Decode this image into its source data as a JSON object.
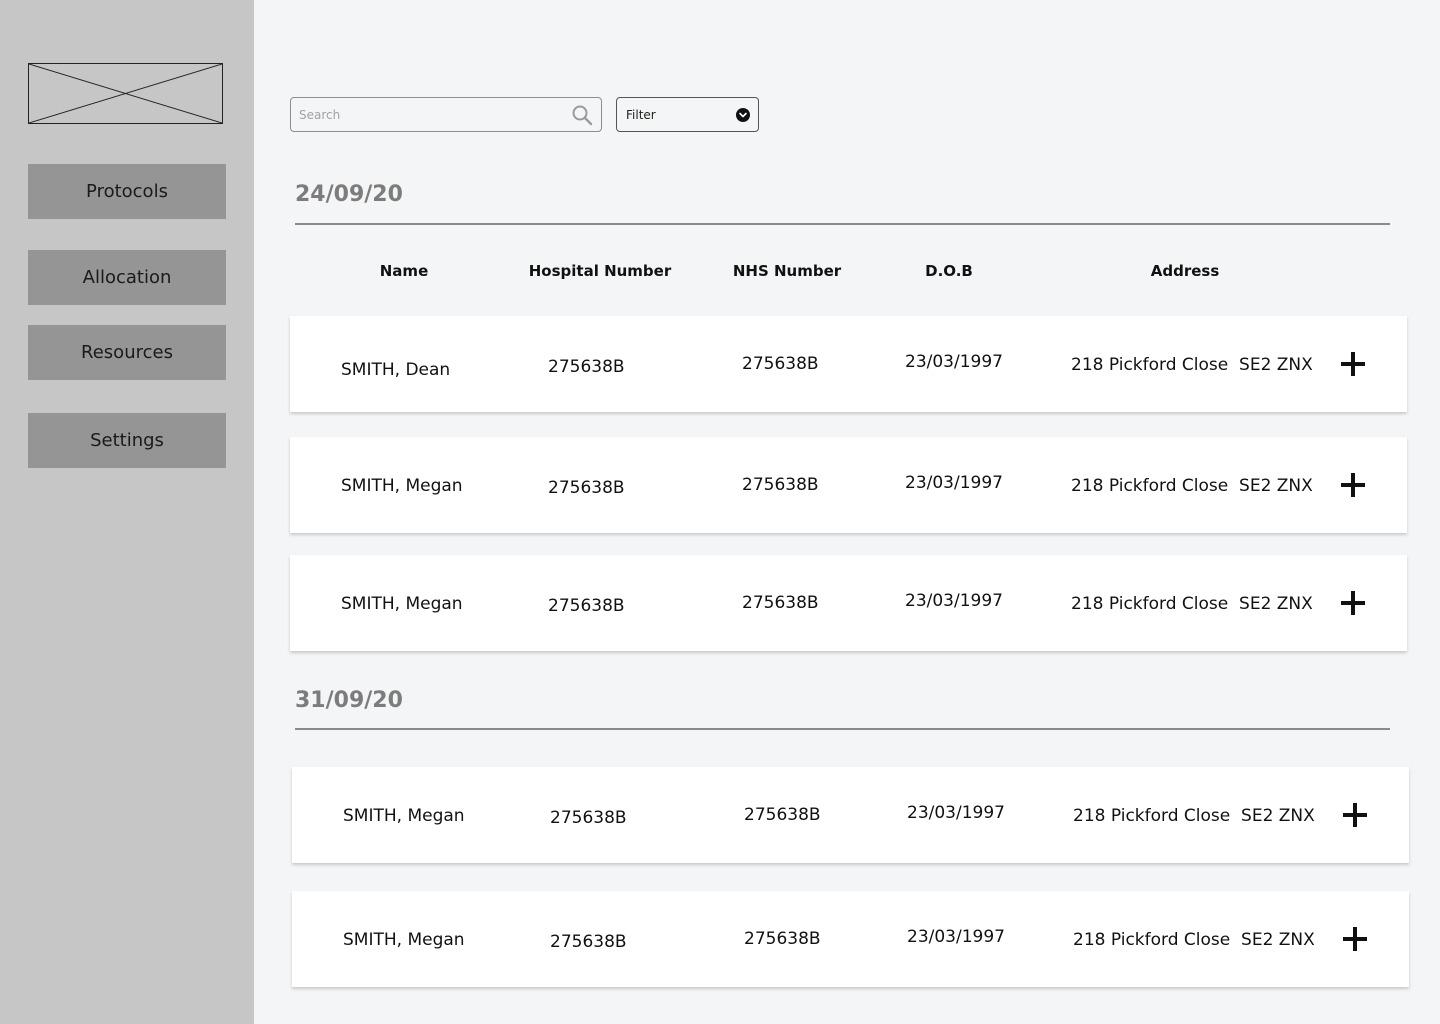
{
  "sidebar": {
    "logo_icon": "image-placeholder-icon",
    "items": [
      {
        "label": "Protocols"
      },
      {
        "label": "Allocation"
      },
      {
        "label": "Resources"
      },
      {
        "label": "Settings"
      }
    ]
  },
  "toolbar": {
    "search_placeholder": "Search",
    "search_icon": "search-icon",
    "filter_label": "Filter",
    "filter_icon": "chevron-down-icon"
  },
  "table": {
    "columns": [
      "Name",
      "Hospital Number",
      "NHS Number",
      "D.O.B",
      "Address"
    ],
    "add_icon": "plus-icon"
  },
  "sections": [
    {
      "date": "24/09/20",
      "rows": [
        {
          "name": "SMITH, Dean",
          "hospital_number": "275638B",
          "nhs_number": "275638B",
          "dob": "23/03/1997",
          "address": "218 Pickford Close  SE2 ZNX"
        },
        {
          "name": "SMITH, Megan",
          "hospital_number": "275638B",
          "nhs_number": "275638B",
          "dob": "23/03/1997",
          "address": "218 Pickford Close  SE2 ZNX"
        },
        {
          "name": "SMITH, Megan",
          "hospital_number": "275638B",
          "nhs_number": "275638B",
          "dob": "23/03/1997",
          "address": "218 Pickford Close  SE2 ZNX"
        }
      ]
    },
    {
      "date": "31/09/20",
      "rows": [
        {
          "name": "SMITH, Megan",
          "hospital_number": "275638B",
          "nhs_number": "275638B",
          "dob": "23/03/1997",
          "address": "218 Pickford Close  SE2 ZNX"
        },
        {
          "name": "SMITH, Megan",
          "hospital_number": "275638B",
          "nhs_number": "275638B",
          "dob": "23/03/1997",
          "address": "218 Pickford Close  SE2 ZNX"
        }
      ]
    }
  ]
}
